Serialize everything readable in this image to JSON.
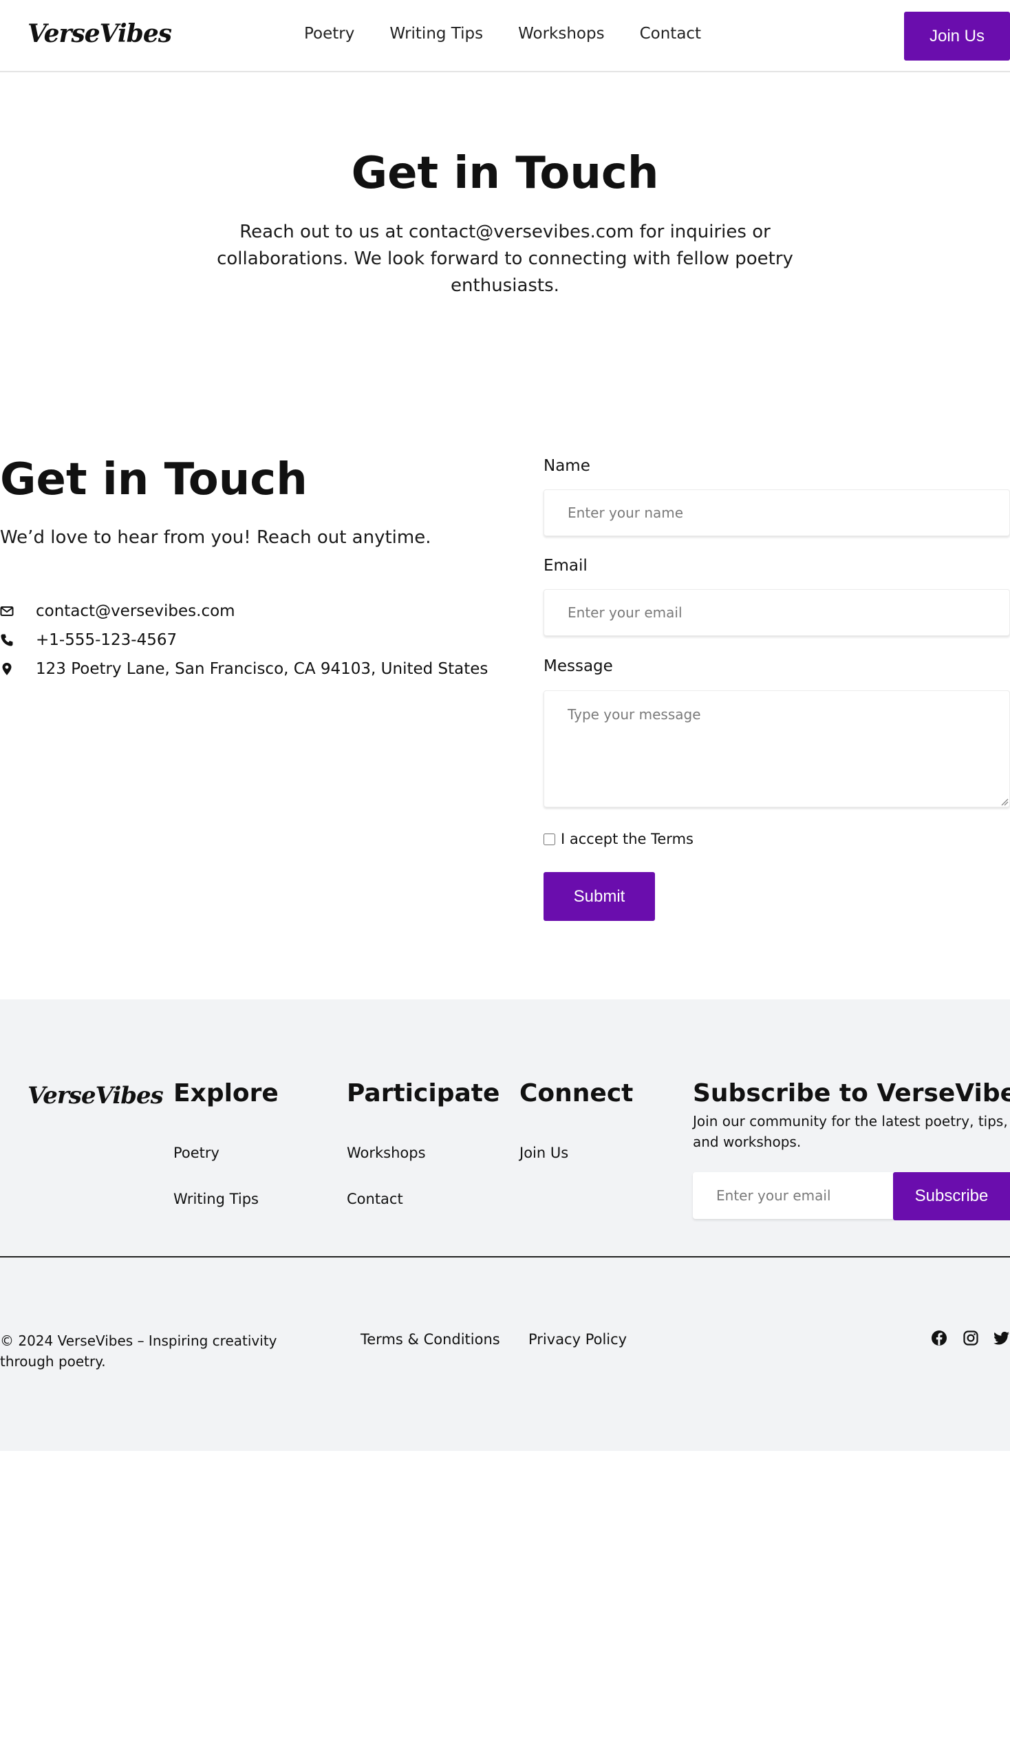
{
  "header": {
    "logo": "VerseVibes",
    "nav": [
      "Poetry",
      "Writing Tips",
      "Workshops",
      "Contact"
    ],
    "cta": "Join Us"
  },
  "hero": {
    "title": "Get in Touch",
    "text": "Reach out to us at contact@versevibes.com for inquiries or collaborations. We look forward to connecting with fellow poetry enthusiasts."
  },
  "contact": {
    "title": "Get in Touch",
    "subtitle": "We’d love to hear from you! Reach out anytime.",
    "email": "contact@versevibes.com",
    "phone": "+1-555-123-4567",
    "address": "123 Poetry Lane, San Francisco, CA 94103, United States"
  },
  "form": {
    "name_label": "Name",
    "name_placeholder": "Enter your name",
    "email_label": "Email",
    "email_placeholder": "Enter your email",
    "message_label": "Message",
    "message_placeholder": "Type your message",
    "terms_label": "I accept the Terms",
    "submit": "Submit"
  },
  "footer": {
    "logo": "VerseVibes",
    "explore": {
      "title": "Explore",
      "links": [
        "Poetry",
        "Writing Tips"
      ]
    },
    "participate": {
      "title": "Participate",
      "links": [
        "Workshops",
        "Contact"
      ]
    },
    "connect": {
      "title": "Connect",
      "links": [
        "Join Us"
      ]
    },
    "subscribe": {
      "title": "Subscribe to VerseVibes",
      "text": "Join our community for the latest poetry, tips, and workshops.",
      "placeholder": "Enter your email",
      "button": "Subscribe"
    },
    "copyright": "© 2024 VerseVibes – Inspiring creativity through poetry.",
    "legal": [
      "Terms & Conditions",
      "Privacy Policy"
    ],
    "social_icons": [
      "facebook-icon",
      "instagram-icon",
      "twitter-icon"
    ]
  },
  "colors": {
    "accent": "#6a0dad",
    "footer_bg": "#f2f3f5"
  }
}
